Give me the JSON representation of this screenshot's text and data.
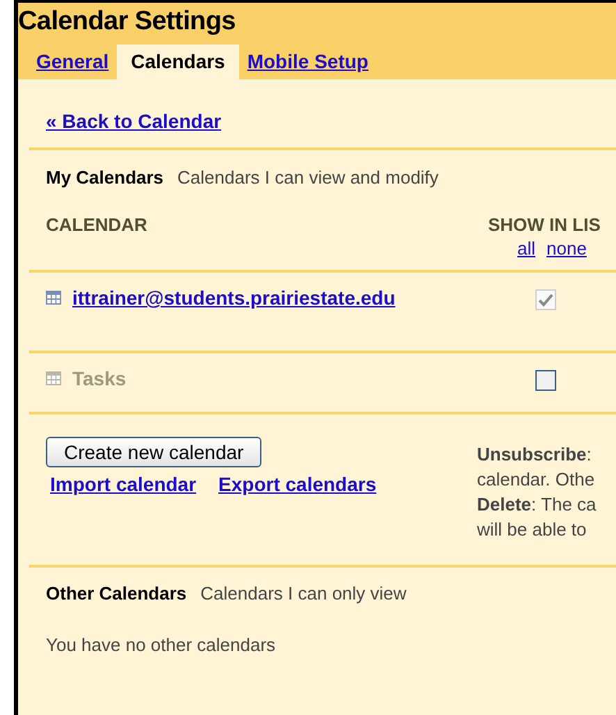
{
  "window": {
    "title": "Calendar Settings"
  },
  "tabs": [
    {
      "label": "General",
      "selected": false
    },
    {
      "label": "Calendars",
      "selected": true
    },
    {
      "label": "Mobile Setup",
      "selected": false
    }
  ],
  "back_link": "« Back to Calendar",
  "my_calendars": {
    "title": "My Calendars",
    "subtitle": "Calendars I can view and modify",
    "columns": {
      "calendar": "CALENDAR",
      "show_in_list": "SHOW IN LIS",
      "all": "all",
      "none": "none"
    },
    "rows": [
      {
        "name": "ittrainer@students.prairiestate.edu",
        "disabled": false,
        "checked": true,
        "checkbox_disabled": true
      },
      {
        "name": "Tasks",
        "disabled": true,
        "checked": false,
        "checkbox_disabled": false
      }
    ],
    "create_button": "Create new calendar",
    "import_link": "Import calendar",
    "export_link": "Export calendars",
    "help_lines": [
      "**Unsubscribe**:",
      "calendar. Othe",
      "**Delete**: The ca",
      "will be able to"
    ]
  },
  "other_calendars": {
    "title": "Other Calendars",
    "subtitle": "Calendars I can only view",
    "empty": "You have no other calendars"
  }
}
